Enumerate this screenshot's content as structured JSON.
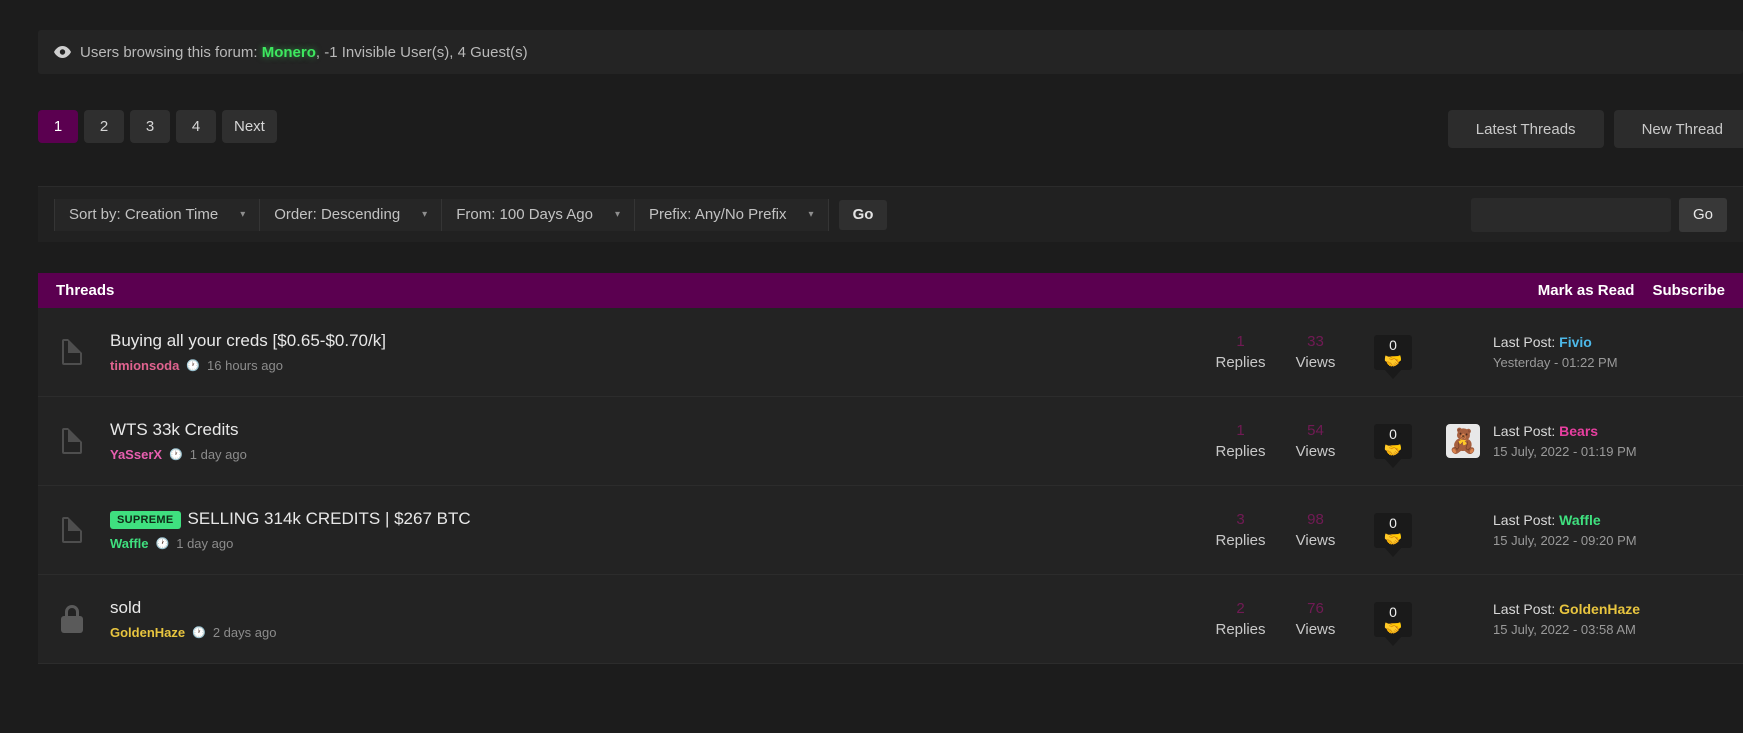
{
  "browsing": {
    "icon": "eye-icon",
    "prefix": "Users browsing this forum:",
    "user": "Monero",
    "suffix": ", -1 Invisible User(s), 4 Guest(s)"
  },
  "pagination": {
    "pages": [
      "1",
      "2",
      "3",
      "4"
    ],
    "active": "1",
    "next_label": "Next"
  },
  "top_actions": {
    "latest_threads": "Latest Threads",
    "new_thread": "New Thread"
  },
  "filters": {
    "sort_by": "Sort by: Creation Time",
    "order": "Order: Descending",
    "from": "From: 100 Days Ago",
    "prefix": "Prefix: Any/No Prefix",
    "go": "Go",
    "search_go": "Go",
    "search_value": ""
  },
  "threads_header": {
    "title": "Threads",
    "mark_as_read": "Mark as Read",
    "subscribe": "Subscribe"
  },
  "columns": {
    "replies_label": "Replies",
    "views_label": "Views"
  },
  "threads": [
    {
      "icon": "document-icon",
      "prefix": null,
      "title": "Buying all your creds [$0.65-$0.70/k]",
      "author": "timionsoda",
      "author_color": "#e0638f",
      "time_ago": "16 hours ago",
      "replies": "1",
      "views": "33",
      "badge_count": "0",
      "badge_emoji": "🤝",
      "avatar_emoji": "",
      "avatar_bg": "",
      "last_post_label": "Last Post:",
      "last_post_user": "Fivio",
      "last_post_user_color": "#4db8e8",
      "last_post_date": "Yesterday - 01:22 PM"
    },
    {
      "icon": "document-icon",
      "prefix": null,
      "title": "WTS 33k Credits",
      "author": "YaSserX",
      "author_color": "#e85fb0",
      "time_ago": "1 day ago",
      "replies": "1",
      "views": "54",
      "badge_count": "0",
      "badge_emoji": "🤝",
      "avatar_emoji": "🧸",
      "avatar_bg": "#e8e8e8",
      "last_post_label": "Last Post:",
      "last_post_user": "Bears",
      "last_post_user_color": "#e83fa0",
      "last_post_date": "15 July, 2022 - 01:19 PM"
    },
    {
      "icon": "document-icon",
      "prefix": "SUPREME",
      "title": "SELLING 314k CREDITS | $267 BTC",
      "author": "Waffle",
      "author_color": "#3fe07f",
      "time_ago": "1 day ago",
      "replies": "3",
      "views": "98",
      "badge_count": "0",
      "badge_emoji": "🤝",
      "avatar_emoji": "",
      "avatar_bg": "",
      "last_post_label": "Last Post:",
      "last_post_user": "Waffle",
      "last_post_user_color": "#3fe07f",
      "last_post_date": "15 July, 2022 - 09:20 PM"
    },
    {
      "icon": "lock-icon",
      "prefix": null,
      "title": "sold",
      "author": "GoldenHaze",
      "author_color": "#e8c53f",
      "time_ago": "2 days ago",
      "replies": "2",
      "views": "76",
      "badge_count": "0",
      "badge_emoji": "🤝",
      "avatar_emoji": "",
      "avatar_bg": "",
      "last_post_label": "Last Post:",
      "last_post_user": "GoldenHaze",
      "last_post_user_color": "#e8c53f",
      "last_post_date": "15 July, 2022 - 03:58 AM"
    }
  ]
}
